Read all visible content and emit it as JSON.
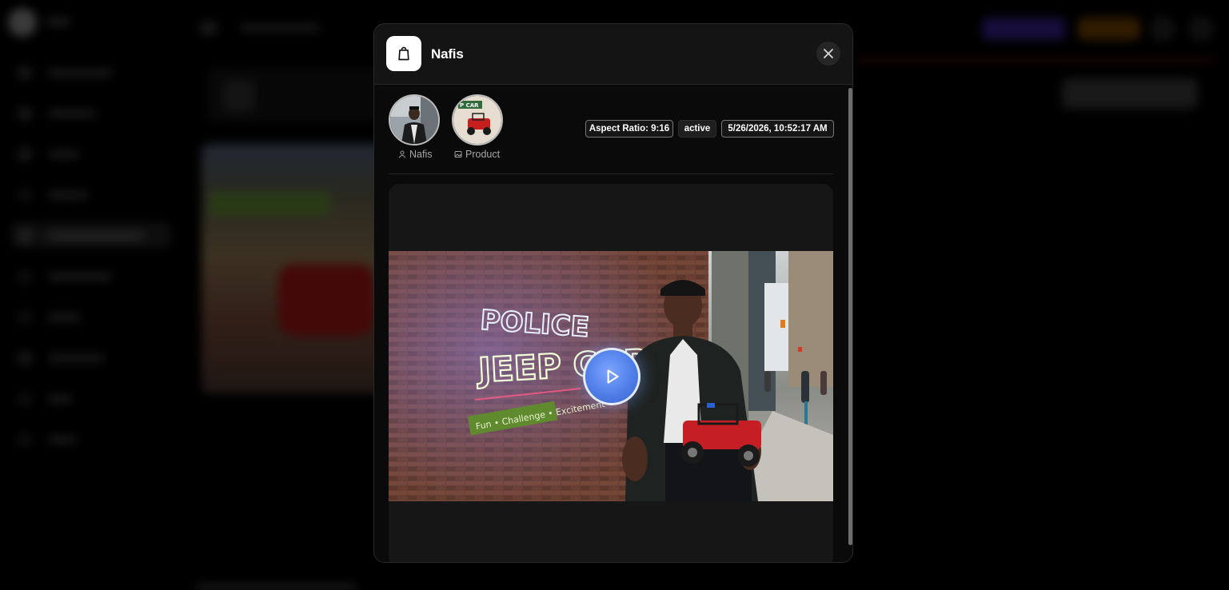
{
  "modal": {
    "title": "Nafis",
    "header_icon": "shopping-bag-icon",
    "close_icon": "close-icon"
  },
  "references": [
    {
      "label": "Nafis",
      "icon": "user-icon"
    },
    {
      "label": "Product",
      "icon": "image-icon"
    }
  ],
  "badges": {
    "aspect_ratio": "Aspect Ratio: 9:16",
    "status": "active",
    "timestamp": "5/26/2026, 10:52:17 AM"
  },
  "video": {
    "play_icon": "play-icon",
    "accent": "#4f7ee8"
  }
}
